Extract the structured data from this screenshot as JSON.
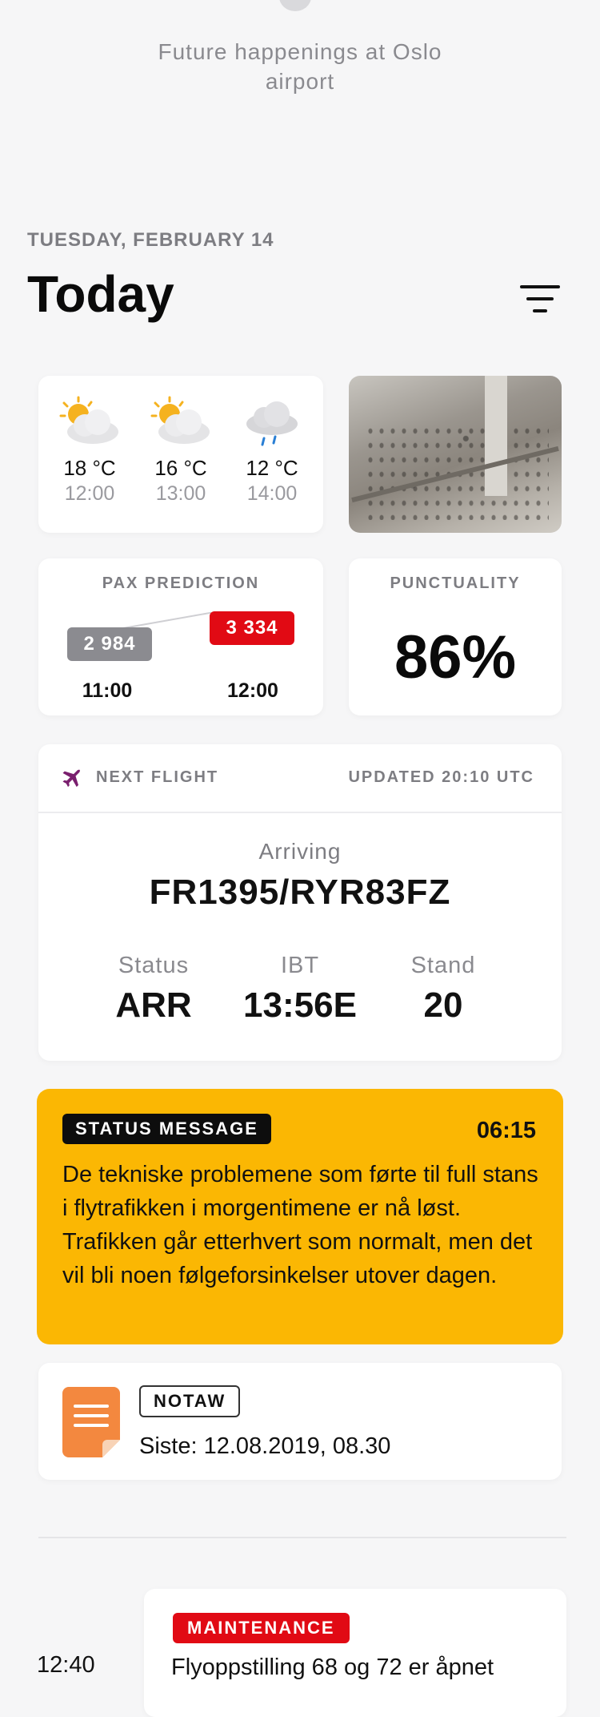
{
  "intro": "Future happenings at Oslo airport",
  "header": {
    "date": "TUESDAY, FEBRUARY 14",
    "title": "Today",
    "filter_icon": "filter-icon"
  },
  "weather": [
    {
      "icon": "partly-sunny-icon",
      "temp": "18 °C",
      "time": "12:00"
    },
    {
      "icon": "partly-sunny-icon",
      "temp": "16 °C",
      "time": "13:00"
    },
    {
      "icon": "rain-cloud-icon",
      "temp": "12 °C",
      "time": "14:00"
    }
  ],
  "pax": {
    "title": "PAX PREDICTION",
    "value_1": "2 984",
    "value_2": "3 334",
    "time_1": "11:00",
    "time_2": "12:00",
    "colors": {
      "low": "#8b8b90",
      "high": "#e10a14"
    }
  },
  "punctuality": {
    "title": "PUNCTUALITY",
    "value": "86%"
  },
  "next_flight": {
    "label": "NEXT FLIGHT",
    "updated": "UPDATED 20:10 UTC",
    "direction": "Arriving",
    "flight_number": "FR1395/RYR83FZ",
    "columns": [
      {
        "label": "Status",
        "value": "ARR"
      },
      {
        "label": "IBT",
        "value": "13:56E"
      },
      {
        "label": "Stand",
        "value": "20"
      }
    ],
    "accent": "#7a1f6e"
  },
  "status_message": {
    "tag": "STATUS MESSAGE",
    "time": "06:15",
    "text": "De tekniske problemene som førte til full stans i flytrafikken i morgentimene er nå løst. Trafikken går etterhvert som normalt, men det vil bli noen følgeforsinkelser utover dagen.",
    "color": "#fbb703"
  },
  "notaw": {
    "tag": "NOTAW",
    "text": "Siste: 12.08.2019, 08.30",
    "icon": "document-icon"
  },
  "timeline": [
    {
      "time": "12:40",
      "tag": "MAINTENANCE",
      "text": "Flyoppstilling 68 og 72 er åpnet"
    }
  ]
}
